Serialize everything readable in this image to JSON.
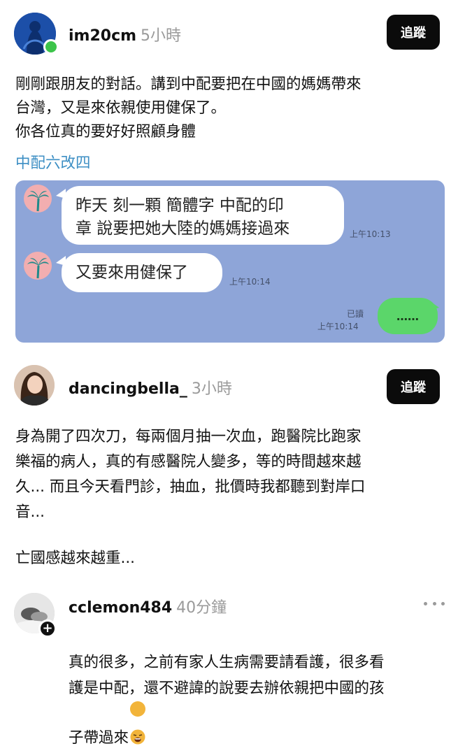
{
  "post1": {
    "username": "im20cm",
    "time": "5小時",
    "follow_label": "追蹤",
    "text": "剛剛跟朋友的對話。講到中配要把在中國的媽媽帶來\n台灣，又是來依親使用健保了。\n你各位真的要好好照顧身體",
    "hashtag": "中配六改四",
    "chat": {
      "messages": [
        {
          "text": "昨天 刻一顆 簡體字 中配的印\n章 說要把她大陸的媽媽接過來",
          "time": "上午10:13"
        },
        {
          "text": "又要來用健保了",
          "time": "上午10:14"
        }
      ],
      "reply": {
        "read_label": "已讀",
        "time": "上午10:14",
        "text": "……"
      }
    }
  },
  "post2": {
    "username": "dancingbella_",
    "time": "3小時",
    "follow_label": "追蹤",
    "text": "身為開了四次刀，每兩個月抽一次血，跑醫院比跑家\n樂福的病人，真的有感醫院人變多，等的時間越來越\n久... 而且今天看門診，抽血，批價時我都聽到對岸口\n音...",
    "text2": "亡國感越來越重..."
  },
  "reply1": {
    "username": "cclemon484",
    "time": "40分鐘",
    "text": "真的很多，之前有家人生病需要請看護，很多看\n護是中配，還不避諱的說要去辦依親把中國的孩\n子帶過來",
    "emoji": "tired-face-emoji"
  },
  "colors": {
    "hashtag": "#3d8fc4",
    "chat_bg": "#8ea5d8",
    "green_bubble": "#5bd66a",
    "button_bg": "#0b0b0b",
    "online": "#3cc44a"
  }
}
